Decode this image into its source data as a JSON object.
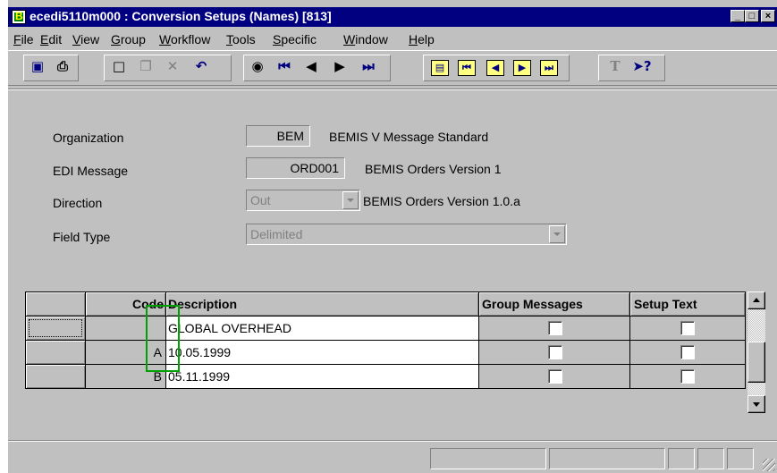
{
  "window": {
    "title": "ecedi5110m000 : Conversion Setups (Names) [813]",
    "app_icon_letter": "B",
    "controls": {
      "minimize": "_",
      "maximize": "□",
      "close": "×"
    }
  },
  "menu": [
    "File",
    "Edit",
    "View",
    "Group",
    "Workflow",
    "Tools",
    "Specific",
    "Window",
    "Help"
  ],
  "toolbar": {
    "icons": [
      "save-icon",
      "print-icon",
      "new-icon",
      "copy-icon",
      "delete-icon",
      "undo-icon",
      "find-icon",
      "first-record-icon",
      "previous-record-icon",
      "next-record-icon",
      "last-record-icon",
      "first-set-icon",
      "previous-set-icon",
      "next-set-icon",
      "last-set-icon",
      "text-icon",
      "help-icon"
    ]
  },
  "form": {
    "organization": {
      "label": "Organization",
      "code": "BEM",
      "description": "BEMIS V Message Standard"
    },
    "edi_message": {
      "label": "EDI Message",
      "code": "ORD001",
      "description": "BEMIS Orders Version 1"
    },
    "direction": {
      "label": "Direction",
      "value": "Out",
      "description": "BEMIS Orders Version 1.0.a"
    },
    "field_type": {
      "label": "Field Type",
      "value": "Delimited"
    }
  },
  "grid": {
    "columns": [
      "Code",
      "Description",
      "Group Messages",
      "Setup Text"
    ],
    "rows": [
      {
        "code": "",
        "description": "GLOBAL OVERHEAD",
        "group_messages": false,
        "setup_text": false
      },
      {
        "code": "A",
        "description": "10.05.1999",
        "group_messages": false,
        "setup_text": false
      },
      {
        "code": "B",
        "description": "05.11.1999",
        "group_messages": false,
        "setup_text": false
      }
    ]
  },
  "colors": {
    "title_bar": "#000080",
    "face": "#c0c0c0",
    "highlight": "#00a000"
  }
}
